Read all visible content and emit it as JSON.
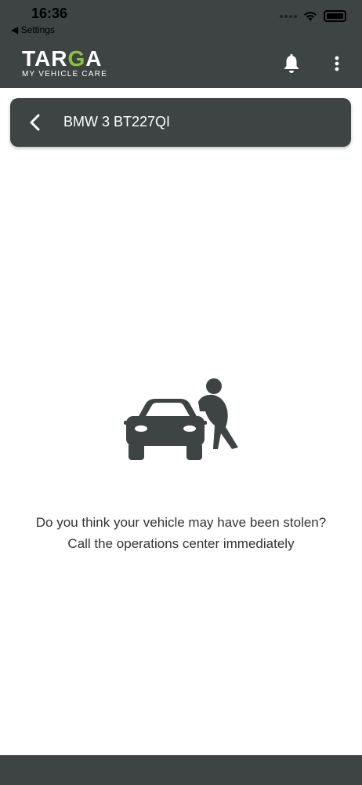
{
  "status_bar": {
    "time": "16:36",
    "back_label": "◀ Settings"
  },
  "header": {
    "logo_main_pre": "TAR",
    "logo_main_accent": "G",
    "logo_main_post": "A",
    "logo_sub": "MY VEHICLE CARE",
    "icons": [
      "bell-icon",
      "more-vertical-icon"
    ]
  },
  "vehicle_bar": {
    "title": "BMW 3 BT227QI",
    "back_icon": "chevron-left-icon"
  },
  "main": {
    "illustration_icon": "car-theft-icon",
    "line1": "Do you think your vehicle may have been stolen?",
    "line2": "Call the operations center immediately"
  },
  "colors": {
    "header_bg": "#3d4443",
    "accent": "#8ec13e",
    "text": "#333333"
  }
}
